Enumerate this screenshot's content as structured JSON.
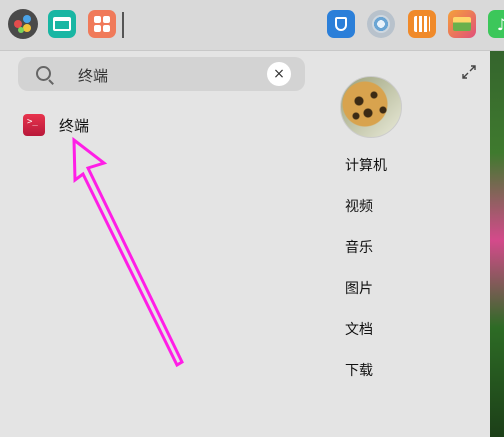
{
  "search": {
    "query": "终端",
    "clear_glyph": "×"
  },
  "results": [
    {
      "label": "终端",
      "icon": "terminal-icon",
      "icon_glyph": ">_"
    }
  ],
  "places": [
    "计算机",
    "视频",
    "音乐",
    "图片",
    "文档",
    "下载"
  ],
  "dock": {
    "apps": [
      "launcher-icon",
      "file-manager-icon",
      "app-store-icon",
      "app-a-icon",
      "browser-icon",
      "app-c-icon",
      "image-viewer-icon",
      "music-icon"
    ]
  },
  "colors": {
    "annotation_arrow": "#ff1ee6",
    "panel_bg": "#e4e4e4",
    "terminal_accent": "#d4253f"
  }
}
